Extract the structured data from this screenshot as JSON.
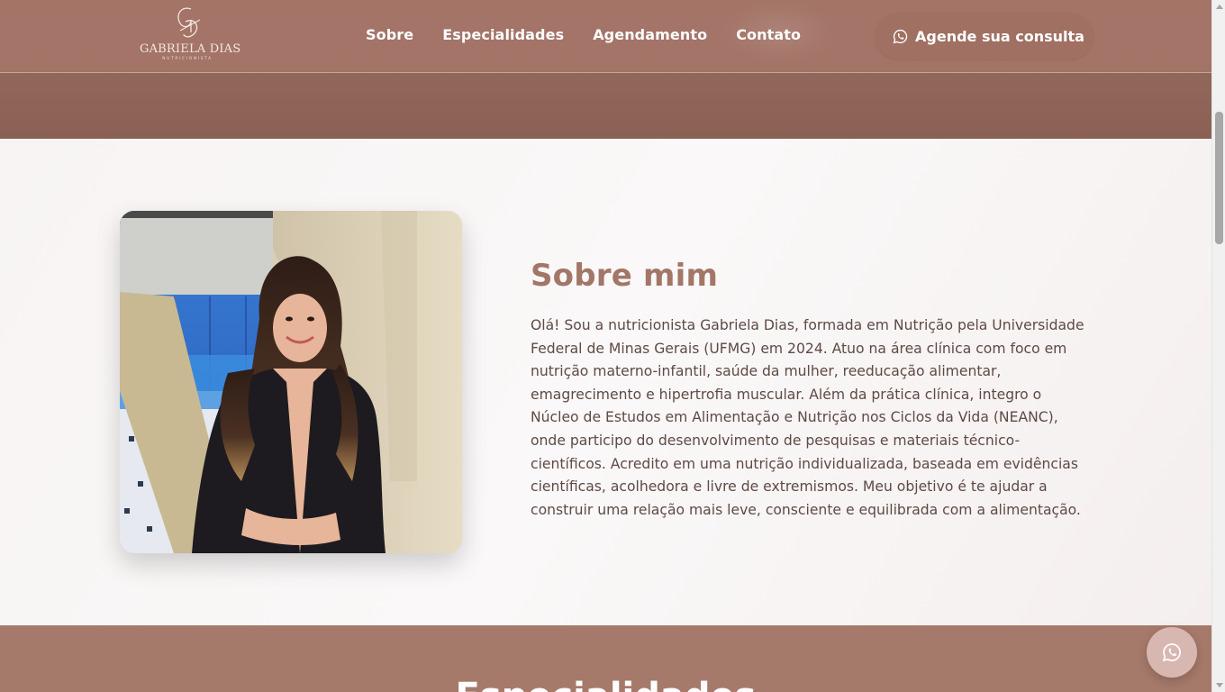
{
  "header": {
    "logo_monogram": "GD",
    "logo_name": "GABRIELA DIAS",
    "logo_subtitle": "NUTRICIONISTA",
    "nav": [
      {
        "label": "Sobre"
      },
      {
        "label": "Especialidades"
      },
      {
        "label": "Agendamento"
      },
      {
        "label": "Contato"
      }
    ],
    "cta_label": "Agende sua consulta",
    "cta_icon": "whatsapp-icon"
  },
  "about": {
    "title": "Sobre mim",
    "text": "Olá! Sou a nutricionista Gabriela Dias, formada em Nutrição pela Universidade Federal de Minas Gerais (UFMG) em 2024. Atuo na área clínica com foco em nutrição materno-infantil, saúde da mulher, reeducação alimentar, emagrecimento e hipertrofia muscular. Além da prática clínica, integro o Núcleo de Estudos em Alimentação e Nutrição nos Ciclos da Vida (NEANC), onde participo do desenvolvimento de pesquisas e materiais técnico-científicos. Acredito em uma nutrição individualizada, baseada em evidências científicas, acolhedora e livre de extremismos. Meu objetivo é te ajudar a construir uma relação mais leve, consciente e equilibrada com a alimentação."
  },
  "specialties": {
    "title": "Especialidades"
  },
  "floating_button": {
    "icon": "whatsapp-icon"
  },
  "colors": {
    "brand": "#a27768",
    "header_bg": "#a37567",
    "section_bg": "#a67a6b",
    "text": "#5e4a45"
  }
}
